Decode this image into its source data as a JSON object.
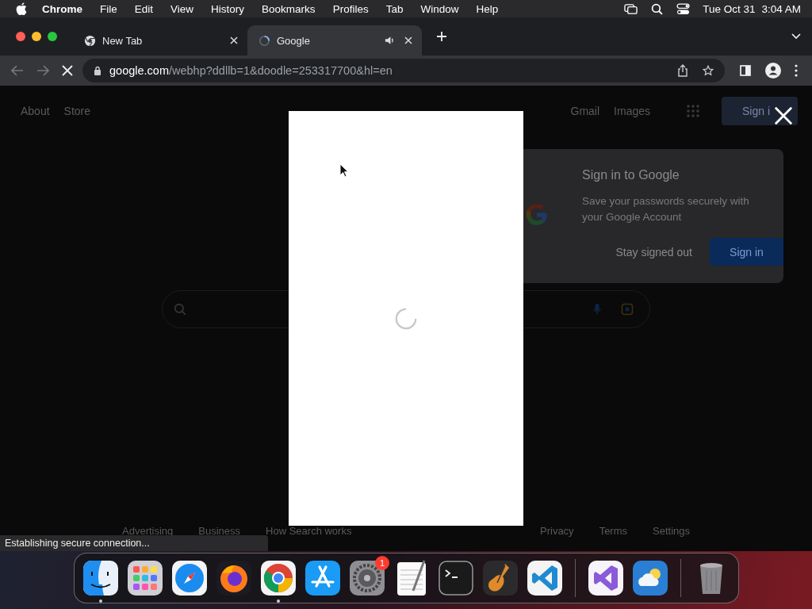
{
  "menu_bar": {
    "app": "Chrome",
    "items": [
      "File",
      "Edit",
      "View",
      "History",
      "Bookmarks",
      "Profiles",
      "Tab",
      "Window",
      "Help"
    ],
    "date": "Tue Oct 31",
    "time": "3:04 AM"
  },
  "tabs": [
    {
      "title": "New Tab",
      "selected": false,
      "audio": false
    },
    {
      "title": "Google",
      "selected": true,
      "audio": true
    }
  ],
  "address_bar": {
    "domain": "google.com",
    "path": "/webhp?ddllb=1&doodle=253317700&hl=en",
    "loading": true
  },
  "page": {
    "nav_left": [
      "About",
      "Store"
    ],
    "nav_right": [
      "Gmail",
      "Images"
    ],
    "sign_in": "Sign i",
    "footer_left": [
      "Advertising",
      "Business",
      "How Search works"
    ],
    "footer_right": [
      "Privacy",
      "Terms",
      "Settings"
    ]
  },
  "signin_card": {
    "title": "Sign in to Google",
    "body": "Save your passwords securely with your Google Account",
    "dismiss": "Stay signed out",
    "confirm": "Sign in"
  },
  "modal": {
    "loading": true
  },
  "status": "Establishing secure connection...",
  "dock": [
    {
      "kind": "finder",
      "running": true
    },
    {
      "kind": "launchpad",
      "running": false
    },
    {
      "kind": "safari",
      "running": false
    },
    {
      "kind": "firefox",
      "running": false
    },
    {
      "kind": "chrome",
      "running": true
    },
    {
      "kind": "appstore",
      "running": false
    },
    {
      "kind": "settings",
      "running": false,
      "badge": "1"
    },
    {
      "kind": "textedit",
      "running": false
    },
    {
      "kind": "terminal",
      "running": false
    },
    {
      "kind": "garageband",
      "running": false
    },
    {
      "kind": "vscode",
      "running": false
    },
    {
      "kind": "divider"
    },
    {
      "kind": "visualstudio",
      "running": false
    },
    {
      "kind": "weather",
      "running": false
    },
    {
      "kind": "divider"
    },
    {
      "kind": "trash",
      "running": false
    }
  ]
}
